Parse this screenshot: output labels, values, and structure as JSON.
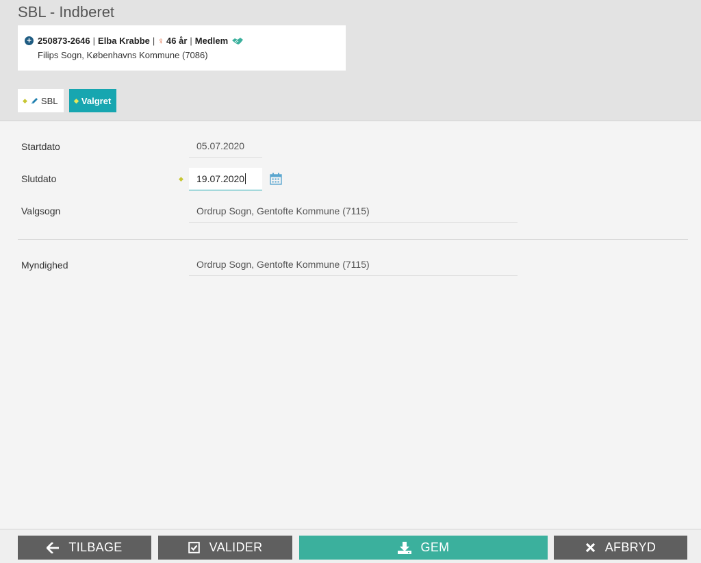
{
  "header": {
    "title": "SBL - Indberet"
  },
  "person": {
    "cpr": "250873-2646",
    "name": "Elba Krabbe",
    "age": "46 år",
    "status": "Medlem",
    "parish": "Filips Sogn, Københavns Kommune (7086)",
    "separator": "|"
  },
  "tabs": [
    {
      "label": "SBL"
    },
    {
      "label": "Valgret"
    }
  ],
  "form": {
    "startdato": {
      "label": "Startdato",
      "value": "05.07.2020"
    },
    "slutdato": {
      "label": "Slutdato",
      "value": "19.07.2020"
    },
    "valgsogn": {
      "label": "Valgsogn",
      "value": "Ordrup Sogn, Gentofte Kommune (7115)"
    },
    "myndighed": {
      "label": "Myndighed",
      "value": "Ordrup Sogn, Gentofte Kommune (7115)"
    }
  },
  "footer": {
    "back_label": "TILBAGE",
    "validate_label": "VALIDER",
    "save_label": "GEM",
    "cancel_label": "AFBRYD"
  },
  "colors": {
    "accent": "#17a6b0",
    "save": "#3bb09d",
    "button_dark": "#5f5f5f",
    "required_marker": "#c7c633"
  },
  "icons": [
    "plus-circle-icon",
    "female-icon",
    "handshake-icon",
    "pencil-icon",
    "calendar-icon",
    "arrow-left-icon",
    "checkbox-icon",
    "download-icon",
    "close-icon"
  ]
}
